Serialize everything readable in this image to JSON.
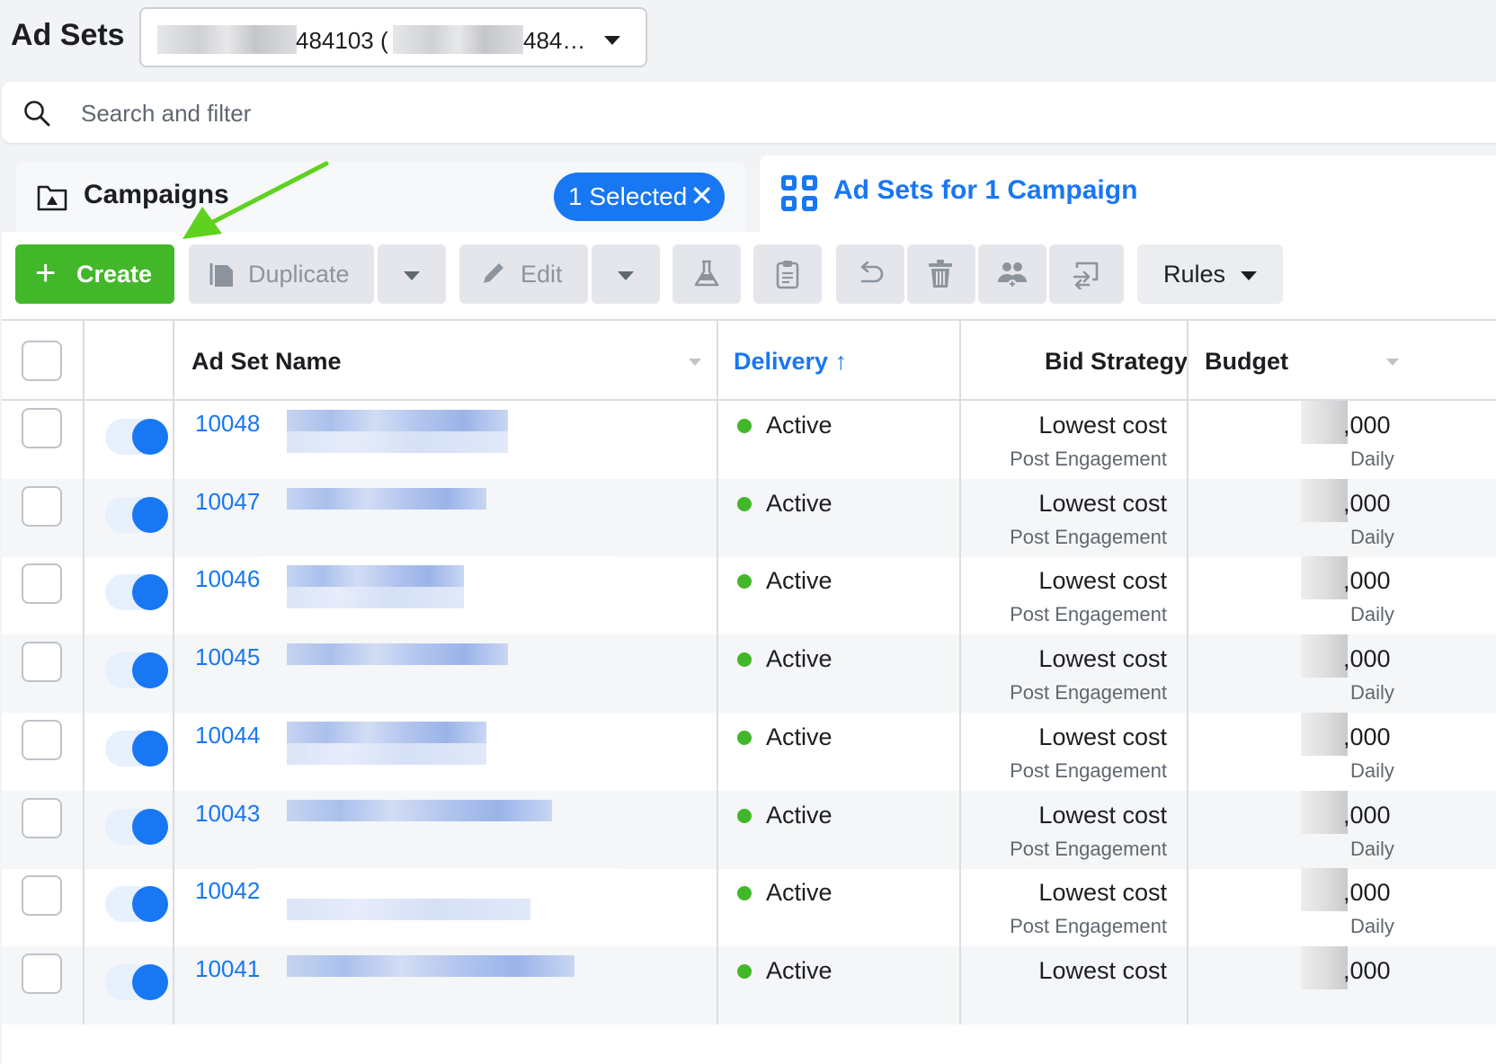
{
  "header": {
    "title": "Ad Sets",
    "account_select": {
      "part1": "484103 (",
      "part2": "484…"
    }
  },
  "search": {
    "placeholder": "Search and filter"
  },
  "tabs": {
    "campaigns": {
      "label": "Campaigns",
      "selected_pill": "1 Selected"
    },
    "adsets": {
      "label": "Ad Sets for 1 Campaign"
    }
  },
  "toolbar": {
    "create_label": "Create",
    "duplicate_label": "Duplicate",
    "edit_label": "Edit",
    "rules_label": "Rules",
    "icons": [
      "flask-icon",
      "clipboard-icon",
      "undo-icon",
      "trash-icon",
      "audience-icon",
      "export-icon"
    ]
  },
  "table": {
    "headers": {
      "name": "Ad Set Name",
      "delivery": "Delivery",
      "bid_strategy": "Bid Strategy",
      "budget": "Budget"
    },
    "rows": [
      {
        "id": "10048",
        "delivery": "Active",
        "bid": "Lowest cost",
        "bid_sub": "Post Engagement",
        "budget": ",000",
        "budget_sub": "Daily"
      },
      {
        "id": "10047",
        "delivery": "Active",
        "bid": "Lowest cost",
        "bid_sub": "Post Engagement",
        "budget": ",000",
        "budget_sub": "Daily"
      },
      {
        "id": "10046",
        "delivery": "Active",
        "bid": "Lowest cost",
        "bid_sub": "Post Engagement",
        "budget": ",000",
        "budget_sub": "Daily"
      },
      {
        "id": "10045",
        "delivery": "Active",
        "bid": "Lowest cost",
        "bid_sub": "Post Engagement",
        "budget": ",000",
        "budget_sub": "Daily"
      },
      {
        "id": "10044",
        "delivery": "Active",
        "bid": "Lowest cost",
        "bid_sub": "Post Engagement",
        "budget": ",000",
        "budget_sub": "Daily"
      },
      {
        "id": "10043",
        "delivery": "Active",
        "bid": "Lowest cost",
        "bid_sub": "Post Engagement",
        "budget": ",000",
        "budget_sub": "Daily"
      },
      {
        "id": "10042",
        "delivery": "Active",
        "bid": "Lowest cost",
        "bid_sub": "Post Engagement",
        "budget": ",000",
        "budget_sub": "Daily"
      },
      {
        "id": "10041",
        "delivery": "Active",
        "bid": "Lowest cost",
        "bid_sub": "",
        "budget": ",000",
        "budget_sub": ""
      }
    ]
  },
  "colors": {
    "brand_blue": "#1877f2",
    "create_green": "#42b72a",
    "annotation_arrow": "#5ed21e"
  }
}
